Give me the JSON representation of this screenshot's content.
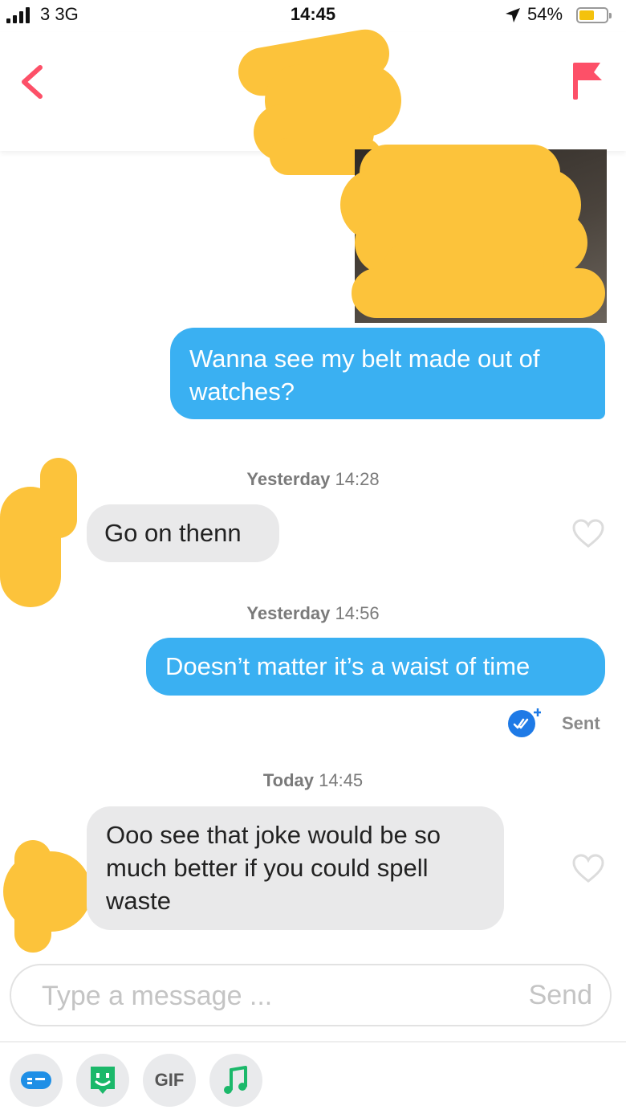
{
  "status_bar": {
    "carrier": "3 3G",
    "time": "14:45",
    "battery": "54%"
  },
  "messages": [
    {
      "direction": "outgoing",
      "text": "Wanna see my belt made out of watches?"
    },
    {
      "timestamp_day": "Yesterday",
      "timestamp_time": "14:28"
    },
    {
      "direction": "incoming",
      "text": "Go on thenn"
    },
    {
      "timestamp_day": "Yesterday",
      "timestamp_time": "14:56"
    },
    {
      "direction": "outgoing",
      "text": "Doesn’t matter it’s a waist of time",
      "status": "Sent"
    },
    {
      "timestamp_day": "Today",
      "timestamp_time": "14:45"
    },
    {
      "direction": "incoming",
      "text": "Ooo see that joke would be so much better if you could spell waste"
    }
  ],
  "composer": {
    "placeholder": "Type a message ...",
    "send_label": "Send"
  },
  "toolbar": {
    "gif_label": "GIF"
  },
  "colors": {
    "accent": "#fd5068",
    "outgoing_bubble": "#3ab0f2",
    "incoming_bubble": "#e9e9ea",
    "redaction": "#fcc33b",
    "read_receipt": "#1e7ae6"
  }
}
